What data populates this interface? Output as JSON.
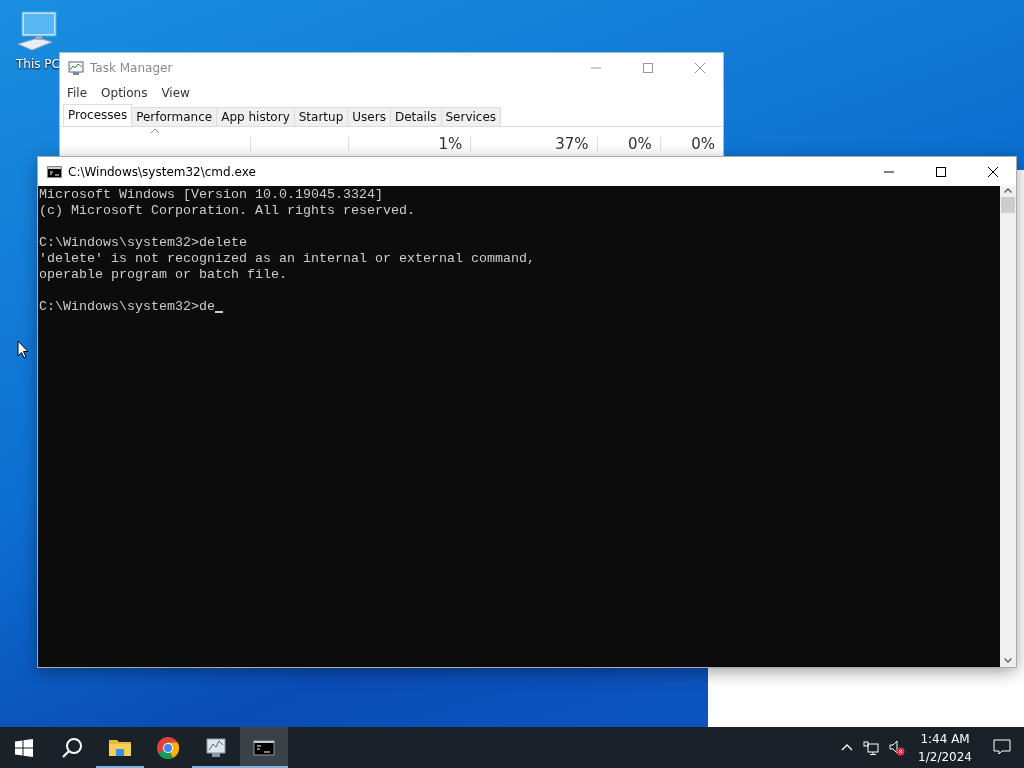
{
  "desktop": {
    "icons": [
      {
        "label": "This PC"
      }
    ]
  },
  "task_manager": {
    "title": "Task Manager",
    "menu": [
      "File",
      "Options",
      "View"
    ],
    "tabs": [
      {
        "label": "Processes",
        "selected": true
      },
      {
        "label": "Performance",
        "selected": false
      },
      {
        "label": "App history",
        "selected": false
      },
      {
        "label": "Startup",
        "selected": false
      },
      {
        "label": "Users",
        "selected": false
      },
      {
        "label": "Details",
        "selected": false
      },
      {
        "label": "Services",
        "selected": false
      }
    ],
    "column_values": [
      "1%",
      "37%",
      "0%",
      "0%"
    ]
  },
  "console": {
    "title": "C:\\Windows\\system32\\cmd.exe",
    "blocks": [
      [
        "Microsoft Windows [Version 10.0.19045.3324]",
        "(c) Microsoft Corporation. All rights reserved."
      ],
      [
        "C:\\Windows\\system32>delete",
        "'delete' is not recognized as an internal or external command,",
        "operable program or batch file."
      ]
    ],
    "prompt": "C:\\Windows\\system32>de"
  },
  "taskbar": {
    "apps": [
      {
        "kind": "explorer",
        "running": true,
        "selected": false
      },
      {
        "kind": "chrome",
        "running": false,
        "selected": false
      },
      {
        "kind": "taskmgr",
        "running": true,
        "selected": false
      },
      {
        "kind": "cmd",
        "running": true,
        "selected": true
      }
    ],
    "clock": {
      "time": "1:44 AM",
      "date": "1/2/2024"
    }
  }
}
